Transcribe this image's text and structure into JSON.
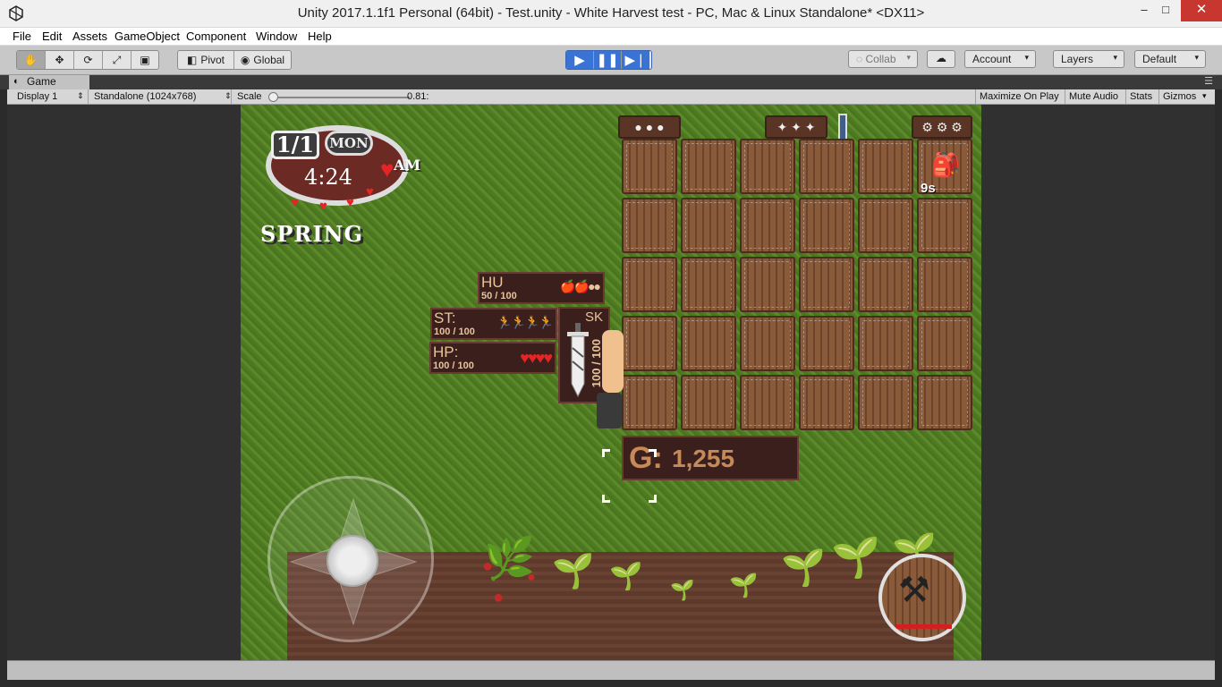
{
  "window": {
    "title": "Unity 2017.1.1f1 Personal (64bit) - Test.unity - White Harvest test - PC, Mac & Linux Standalone* <DX11>",
    "minimize_glyph": "–",
    "maximize_glyph": "□",
    "close_glyph": "✕"
  },
  "menu": [
    "File",
    "Edit",
    "Assets",
    "GameObject",
    "Component",
    "Window",
    "Help"
  ],
  "toolbar": {
    "pivot_label": "Pivot",
    "global_label": "Global",
    "collab_label": "Collab",
    "account_label": "Account",
    "layers_label": "Layers",
    "layout_label": "Default",
    "dropdown_glyph": "▾"
  },
  "game_tab": {
    "label": "Game",
    "display": "Display 1",
    "resolution": "Standalone (1024x768)",
    "scale_label": "Scale",
    "scale_value": "0.81:",
    "maximize_label": "Maximize On Play",
    "mute_label": "Mute Audio",
    "stats_label": "Stats",
    "gizmos_label": "Gizmos"
  },
  "game": {
    "date": "1/1",
    "day": "MON",
    "time": "4:24",
    "ampm": "AM",
    "season": "SPRING",
    "hunger": {
      "label": "HU",
      "value": "50 / 100",
      "icons": "🍎🍎●●"
    },
    "stamina": {
      "label": "ST:",
      "value": "100 / 100",
      "icons": "🏃🏃🏃🏃"
    },
    "health": {
      "label": "HP:",
      "value": "100 / 100",
      "icons": "♥♥♥♥"
    },
    "skill": {
      "label": "SK",
      "value": "100 / 100"
    },
    "gold": {
      "label": "G:",
      "value": "1,255"
    },
    "seed_count": "9s"
  },
  "colors": {
    "close_button": "#c7372f",
    "play_active": "#3a73d6",
    "grass": "#5b8a2a",
    "panel": "#3a1f1c",
    "panel_text": "#e8c49a",
    "gold_text": "#c58a57",
    "heart": "#e52525"
  }
}
